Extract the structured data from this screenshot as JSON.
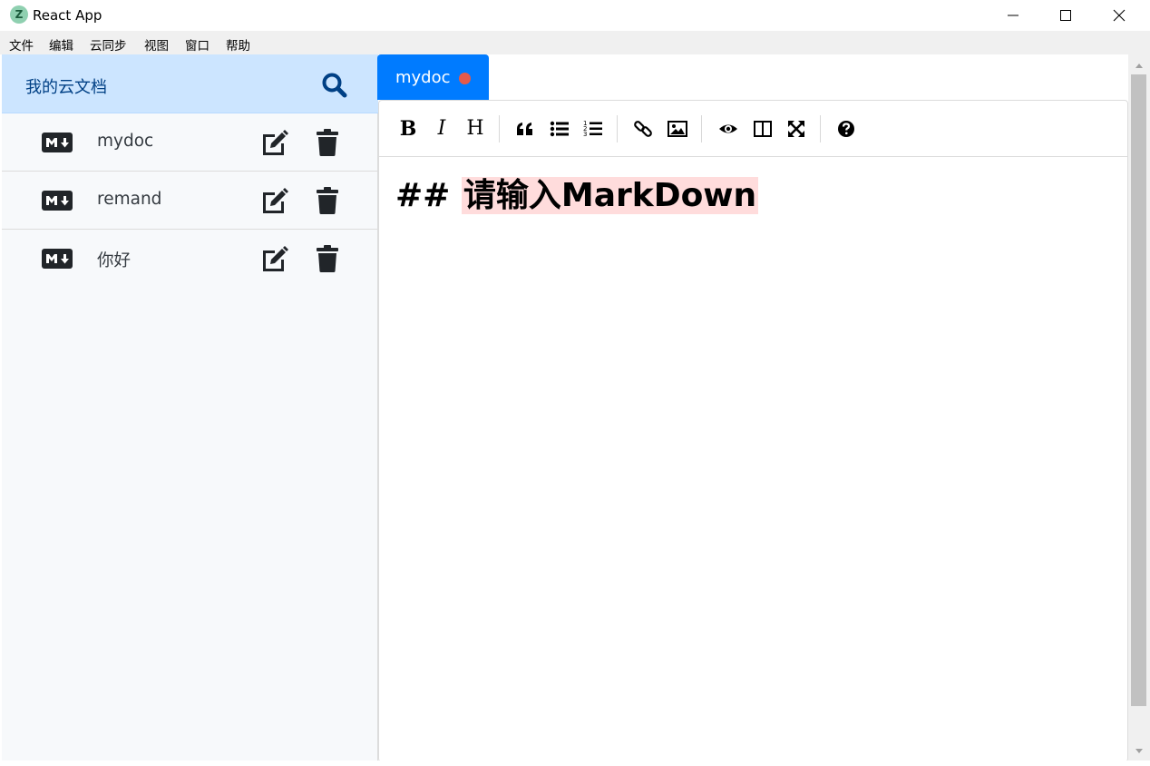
{
  "window": {
    "title": "React App",
    "icon_letter": "Z",
    "controls": [
      "minimize-icon",
      "maximize-icon",
      "close-icon"
    ]
  },
  "menu": {
    "items": [
      "文件",
      "编辑",
      "云同步",
      "视图",
      "窗口",
      "帮助"
    ]
  },
  "sidebar": {
    "title": "我的云文档",
    "search_icon": "search-icon",
    "files": [
      {
        "name": "mydoc",
        "icon": "markdown-icon"
      },
      {
        "name": "remand",
        "icon": "markdown-icon"
      },
      {
        "name": "你好",
        "icon": "markdown-icon"
      }
    ],
    "item_actions": [
      "edit-icon",
      "trash-icon"
    ]
  },
  "tabs": [
    {
      "label": "mydoc",
      "active": true,
      "unsaved": true
    }
  ],
  "toolbar": {
    "bold": "B",
    "italic": "I",
    "heading": "H",
    "groups": [
      [
        "bold-icon",
        "italic-icon",
        "heading-icon"
      ],
      [
        "quote-icon",
        "unordered-list-icon",
        "ordered-list-icon"
      ],
      [
        "link-icon",
        "image-icon"
      ],
      [
        "preview-icon",
        "side-by-side-icon",
        "fullscreen-icon"
      ],
      [
        "help-icon"
      ]
    ]
  },
  "editor": {
    "prefix": "## ",
    "heading_text": "请输入MarkDown"
  },
  "colors": {
    "sidebar_header_bg": "#cce5ff",
    "sidebar_title": "#004085",
    "search_icon": "#004085",
    "tab_active_bg": "#007bff",
    "unsaved_dot": "#e55a4a",
    "heading_highlight": "#ffdcdc",
    "sidebar_bg": "#f7f9fb"
  }
}
